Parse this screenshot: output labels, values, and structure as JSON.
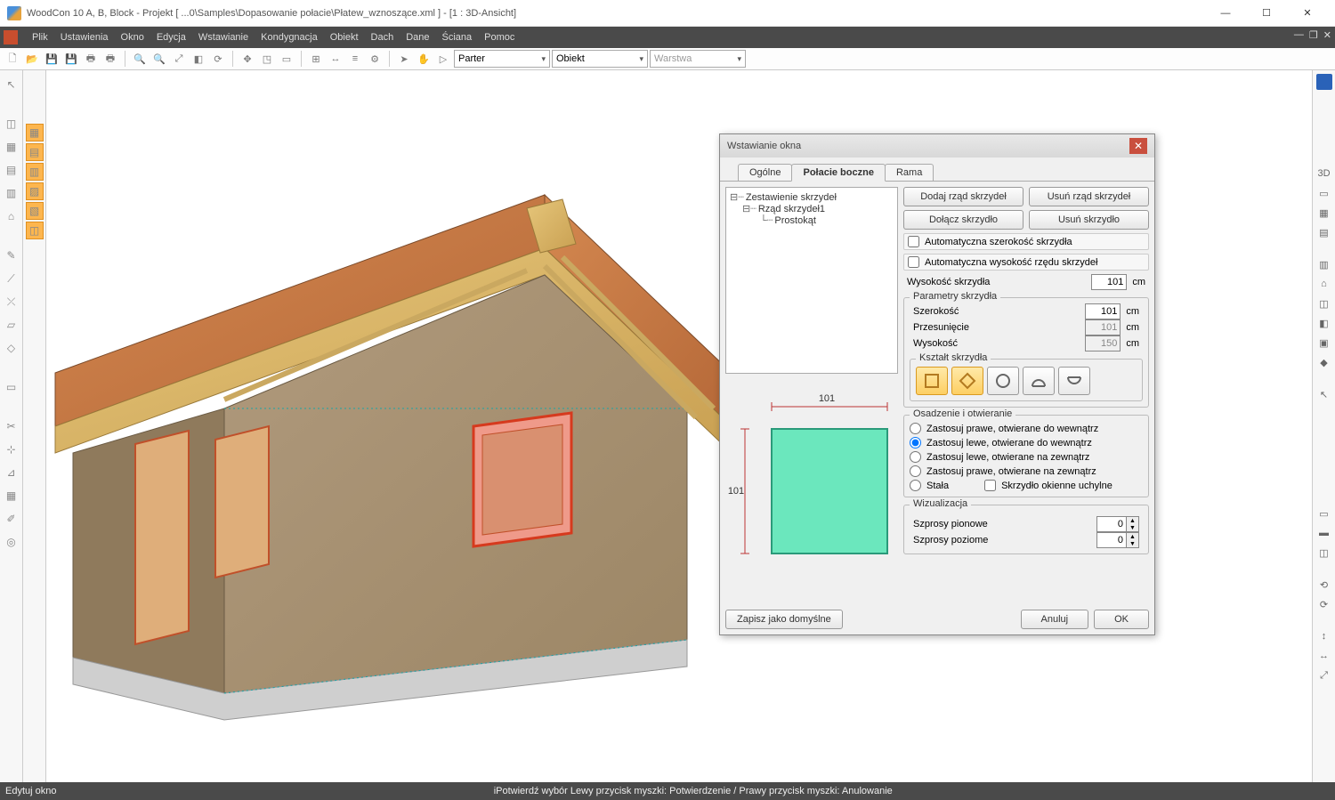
{
  "title": "WoodCon 10 A, B, Block - Projekt [ ...0\\Samples\\Dopasowanie połacie\\Płatew_wznoszące.xml ]  - [1 : 3D-Ansicht]",
  "menu": [
    "Plik",
    "Ustawienia",
    "Okno",
    "Edycja",
    "Wstawianie",
    "Kondygnacja",
    "Obiekt",
    "Dach",
    "Dane",
    "Ściana",
    "Pomoc"
  ],
  "combo": {
    "floor": "Parter",
    "element": "Obiekt",
    "layer": "Warstwa"
  },
  "status": {
    "left": "Edytuj okno",
    "right": "iPotwierdź wybór Lewy przycisk myszki: Potwierdzenie / Prawy przycisk myszki: Anulowanie"
  },
  "dialog": {
    "title": "Wstawianie okna",
    "tabs": [
      "Ogólne",
      "Połacie boczne",
      "Rama"
    ],
    "active_tab": 1,
    "tree": {
      "root": "Zestawienie skrzydeł",
      "row": "Rząd skrzydeł1",
      "leaf": "Prostokąt"
    },
    "buttons": {
      "addrow": "Dodaj rząd skrzydeł",
      "delrow": "Usuń rząd skrzydeł",
      "addwing": "Dołącz skrzydło",
      "delwing": "Usuń skrzydło"
    },
    "checks": {
      "autoW": "Automatyczna szerokość skrzydła",
      "autoH": "Automatyczna wysokość rzędu skrzydeł"
    },
    "fields": {
      "wingH": {
        "label": "Wysokość skrzydła",
        "value": "101",
        "unit": "cm"
      },
      "paramTitle": "Parametry skrzydła",
      "width": {
        "label": "Szerokość",
        "value": "101",
        "unit": "cm"
      },
      "offset": {
        "label": "Przesunięcie",
        "value": "101",
        "unit": "cm"
      },
      "height": {
        "label": "Wysokość",
        "value": "150",
        "unit": "cm"
      }
    },
    "shapeTitle": "Kształt skrzydła",
    "osadzenieTitle": "Osadzenie i otwieranie",
    "radios": [
      "Zastosuj prawe, otwierane do wewnątrz",
      "Zastosuj lewe, otwierane do wewnątrz",
      "Zastosuj lewe, otwierane na zewnątrz",
      "Zastosuj prawe, otwierane na zewnątrz",
      "Stała"
    ],
    "radio_sel": 1,
    "tilt": "Skrzydło okienne uchylne",
    "vizTitle": "Wizualizacja",
    "spV": {
      "label": "Szprosy pionowe",
      "value": "0"
    },
    "spH": {
      "label": "Szprosy poziome",
      "value": "0"
    },
    "foot": {
      "save": "Zapisz jako domyślne",
      "cancel": "Anuluj",
      "ok": "OK"
    },
    "preview": {
      "w": "101",
      "h": "101"
    }
  }
}
